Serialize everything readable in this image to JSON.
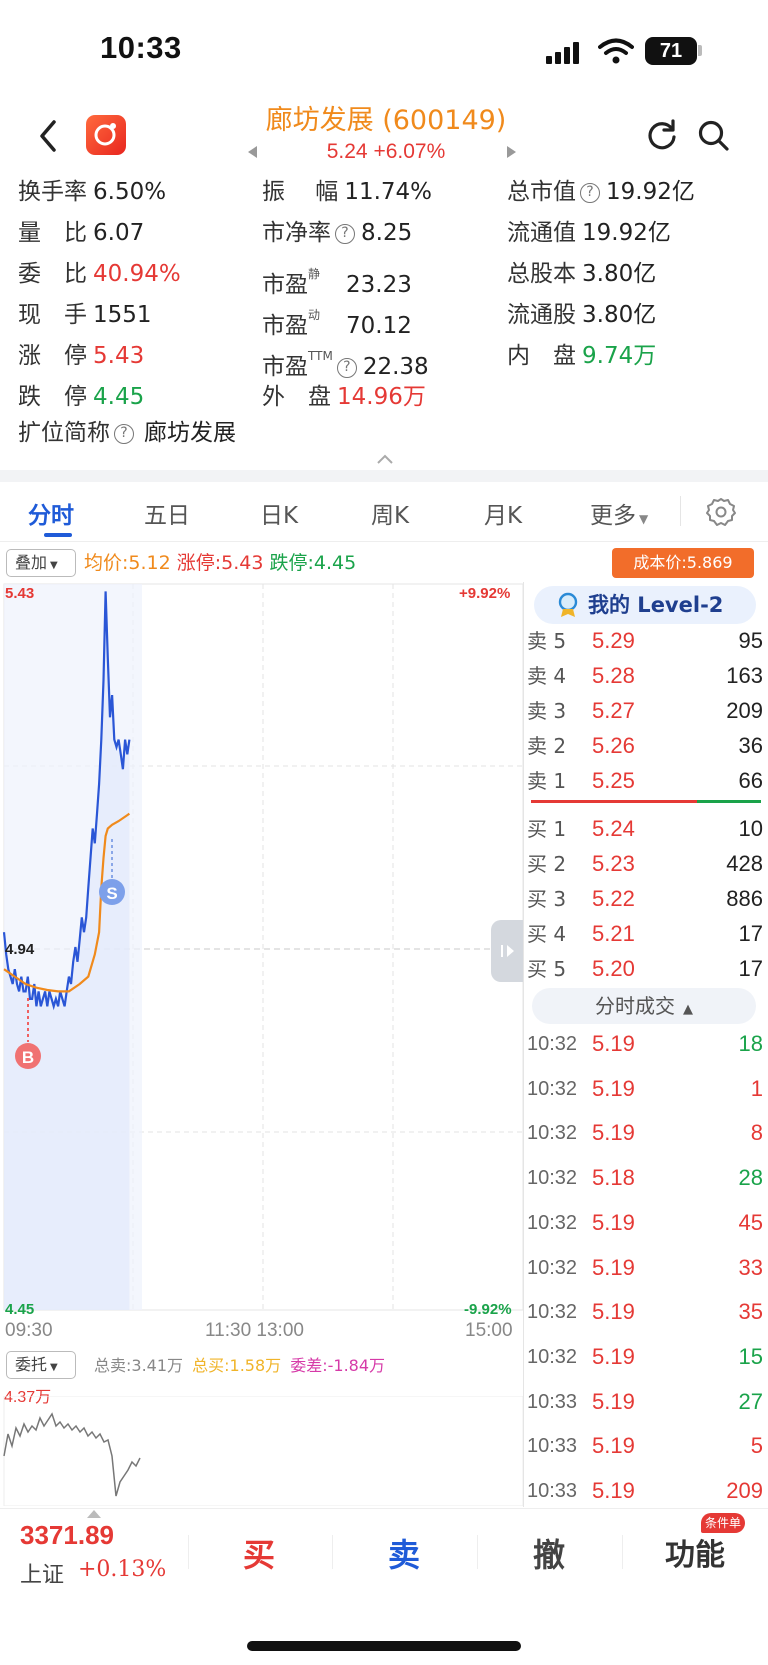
{
  "status_bar": {
    "time": "10:33",
    "battery": "71"
  },
  "header": {
    "title": "廊坊发展 (600149)",
    "price_line": "5.24 +6.07%"
  },
  "stats": {
    "turnover_label": "换手率",
    "turnover": "6.50%",
    "amplitude_label": "振　 幅",
    "amplitude": "11.74%",
    "market_cap_label": "总市值",
    "market_cap": "19.92亿",
    "volume_ratio_label": "量　比",
    "volume_ratio": "6.07",
    "pb_label": "市净率",
    "pb": "8.25",
    "float_cap_label": "流通值",
    "float_cap": "19.92亿",
    "commission_ratio_label": "委　比",
    "commission_ratio": "40.94%",
    "pe_static_label": "市盈",
    "pe_static_sup": "静",
    "pe_static": "23.23",
    "total_shares_label": "总股本",
    "total_shares": "3.80亿",
    "current_hand_label": "现　手",
    "current_hand": "1551",
    "pe_dynamic_label": "市盈",
    "pe_dynamic_sup": "动",
    "pe_dynamic": "70.12",
    "float_shares_label": "流通股",
    "float_shares": "3.80亿",
    "limit_up_label": "涨　停",
    "limit_up": "5.43",
    "pe_ttm_label": "市盈",
    "pe_ttm_sup": "TTM",
    "pe_ttm": "22.38",
    "inner_label": "内　盘",
    "inner": "9.74万",
    "limit_down_label": "跌　停",
    "limit_down": "4.45",
    "outer_label": "外　盘",
    "outer": "14.96万",
    "short_name_label": "扩位简称",
    "short_name": "廊坊发展"
  },
  "tabs": [
    "分时",
    "五日",
    "日K",
    "周K",
    "月K",
    "更多"
  ],
  "overlay": {
    "button": "叠加",
    "avg": "均价:5.12",
    "up": "涨停:5.43",
    "down": "跌停:4.45",
    "cost": "成本价:5.869"
  },
  "chart_labels": {
    "y_top": "5.43",
    "y_mid": "4.94",
    "y_bottom": "4.45",
    "pct_top": "+9.92%",
    "pct_bottom": "-9.92%",
    "x_ticks": [
      "09:30",
      "11:30 13:00",
      "15:00"
    ],
    "buy_marker": "B",
    "sell_marker": "S"
  },
  "chart_data": {
    "type": "line",
    "ylim": [
      4.45,
      5.43
    ],
    "x_range_minutes": [
      0,
      240
    ],
    "series": [
      {
        "values": [
          [
            0,
            4.96
          ],
          [
            1,
            4.93
          ],
          [
            2,
            4.91
          ],
          [
            3,
            4.9
          ],
          [
            4,
            4.89
          ],
          [
            5,
            4.91
          ],
          [
            6,
            4.89
          ],
          [
            7,
            4.88
          ],
          [
            8,
            4.9
          ],
          [
            9,
            4.88
          ],
          [
            10,
            4.88
          ],
          [
            11,
            4.9
          ],
          [
            12,
            4.87
          ],
          [
            13,
            4.87
          ],
          [
            14,
            4.89
          ],
          [
            15,
            4.86
          ],
          [
            16,
            4.88
          ],
          [
            17,
            4.86
          ],
          [
            18,
            4.87
          ],
          [
            19,
            4.88
          ],
          [
            20,
            4.86
          ],
          [
            21,
            4.88
          ],
          [
            22,
            4.87
          ],
          [
            23,
            4.86
          ],
          [
            24,
            4.87
          ],
          [
            25,
            4.86
          ],
          [
            26,
            4.88
          ],
          [
            27,
            4.87
          ],
          [
            28,
            4.86
          ],
          [
            29,
            4.88
          ],
          [
            30,
            4.9
          ],
          [
            31,
            4.89
          ],
          [
            32,
            4.92
          ],
          [
            33,
            4.94
          ],
          [
            34,
            4.92
          ],
          [
            35,
            4.95
          ],
          [
            36,
            4.98
          ],
          [
            37,
            4.96
          ],
          [
            38,
            4.98
          ],
          [
            39,
            5.02
          ],
          [
            40,
            5.06
          ],
          [
            41,
            5.1
          ],
          [
            42,
            5.08
          ],
          [
            43,
            5.12
          ],
          [
            44,
            5.16
          ],
          [
            45,
            5.22
          ],
          [
            46,
            5.3
          ],
          [
            47,
            5.42
          ],
          [
            48,
            5.33
          ],
          [
            49,
            5.25
          ],
          [
            50,
            5.28
          ],
          [
            51,
            5.22
          ],
          [
            52,
            5.21
          ],
          [
            53,
            5.22
          ],
          [
            54,
            5.2
          ],
          [
            55,
            5.18
          ],
          [
            56,
            5.22
          ],
          [
            57,
            5.2
          ],
          [
            58,
            5.22
          ]
        ]
      },
      {
        "values": [
          [
            0,
            4.91
          ],
          [
            5,
            4.9
          ],
          [
            10,
            4.89
          ],
          [
            15,
            4.885
          ],
          [
            20,
            4.882
          ],
          [
            25,
            4.88
          ],
          [
            30,
            4.88
          ],
          [
            35,
            4.89
          ],
          [
            39,
            4.9
          ],
          [
            42,
            4.93
          ],
          [
            44,
            4.96
          ],
          [
            45,
            5.02
          ],
          [
            46,
            5.06
          ],
          [
            47,
            5.09
          ],
          [
            48,
            5.1
          ],
          [
            50,
            5.105
          ],
          [
            53,
            5.11
          ],
          [
            58,
            5.12
          ]
        ]
      }
    ]
  },
  "level2": {
    "title": "我的 Level-2",
    "asks": [
      {
        "side": "卖 5",
        "price": "5.29",
        "vol": "95"
      },
      {
        "side": "卖 4",
        "price": "5.28",
        "vol": "163"
      },
      {
        "side": "卖 3",
        "price": "5.27",
        "vol": "209"
      },
      {
        "side": "卖 2",
        "price": "5.26",
        "vol": "36"
      },
      {
        "side": "卖 1",
        "price": "5.25",
        "vol": "66"
      }
    ],
    "bids": [
      {
        "side": "买 1",
        "price": "5.24",
        "vol": "10"
      },
      {
        "side": "买 2",
        "price": "5.23",
        "vol": "428"
      },
      {
        "side": "买 3",
        "price": "5.22",
        "vol": "886"
      },
      {
        "side": "买 4",
        "price": "5.21",
        "vol": "17"
      },
      {
        "side": "买 5",
        "price": "5.20",
        "vol": "17"
      }
    ],
    "trades_title": "分时成交",
    "trades": [
      {
        "time": "10:32",
        "price": "5.19",
        "vol": "18",
        "dir": "green"
      },
      {
        "time": "10:32",
        "price": "5.19",
        "vol": "1",
        "dir": "red"
      },
      {
        "time": "10:32",
        "price": "5.19",
        "vol": "8",
        "dir": "red"
      },
      {
        "time": "10:32",
        "price": "5.18",
        "vol": "28",
        "dir": "green"
      },
      {
        "time": "10:32",
        "price": "5.19",
        "vol": "45",
        "dir": "red"
      },
      {
        "time": "10:32",
        "price": "5.19",
        "vol": "33",
        "dir": "red"
      },
      {
        "time": "10:32",
        "price": "5.19",
        "vol": "35",
        "dir": "red"
      },
      {
        "time": "10:32",
        "price": "5.19",
        "vol": "15",
        "dir": "green"
      },
      {
        "time": "10:33",
        "price": "5.19",
        "vol": "27",
        "dir": "green"
      },
      {
        "time": "10:33",
        "price": "5.19",
        "vol": "5",
        "dir": "red"
      },
      {
        "time": "10:33",
        "price": "5.19",
        "vol": "209",
        "dir": "red"
      }
    ]
  },
  "delegation": {
    "button": "委托",
    "total_sell": "总卖:3.41万",
    "total_buy": "总买:1.58万",
    "diff": "委差:-1.84万",
    "vol_top": "4.37万"
  },
  "bottom": {
    "index_value": "3371.89",
    "index_name": "上证",
    "index_change": "+0.13%",
    "buy": "买",
    "sell": "卖",
    "cancel": "撤",
    "functions": "功能",
    "cond_badge": "条件单"
  },
  "colors": {
    "red": "#e53935",
    "green": "#1aa34a",
    "blue": "#1f5bd8",
    "orange": "#f08a1c",
    "price_line": "#2a56d6",
    "avg_line": "#f08a1c"
  }
}
